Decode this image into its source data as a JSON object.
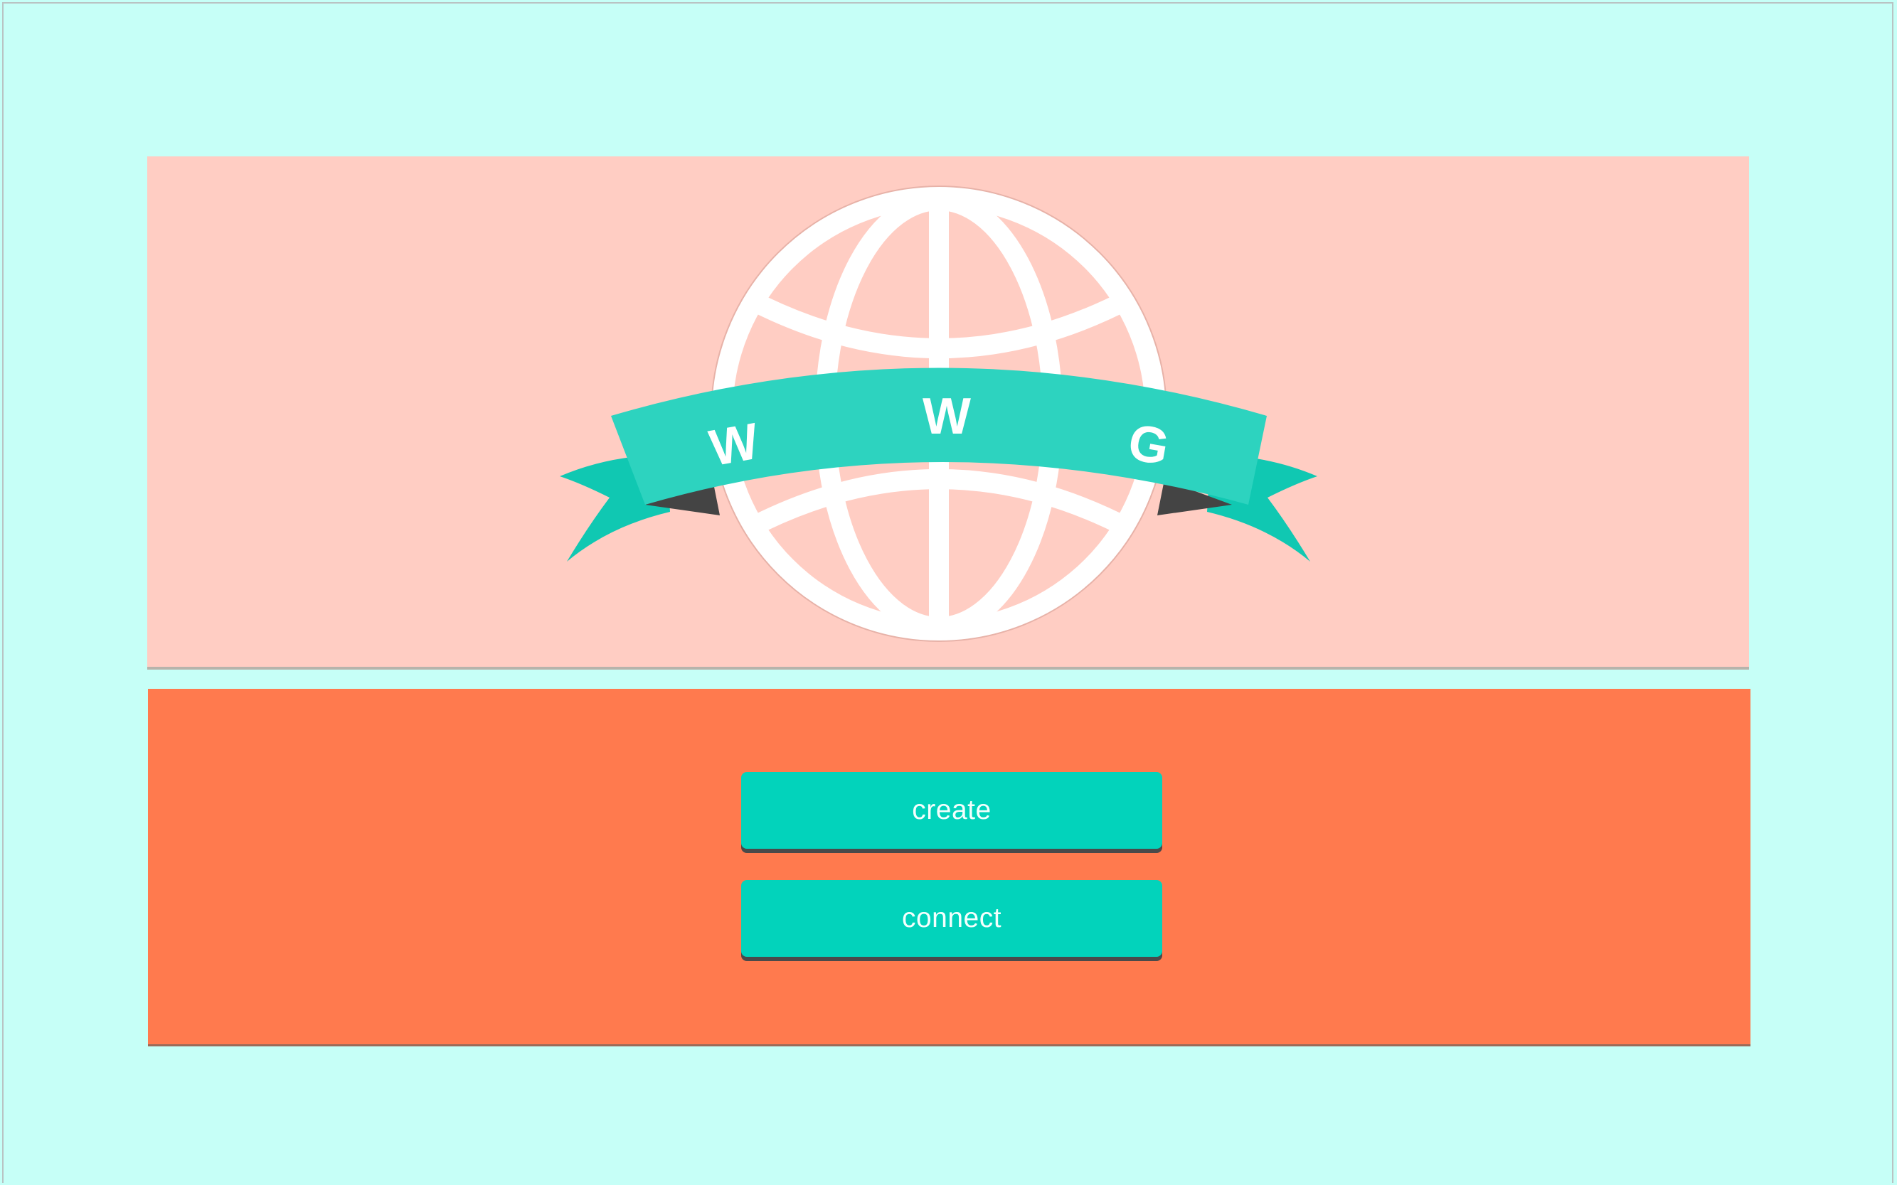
{
  "app": {
    "logo": {
      "icon": "globe-with-ribbon",
      "letters": [
        "W",
        "W",
        "G"
      ],
      "colors": {
        "globe": "#ffffff",
        "ribbon": "#2dd3bf",
        "ribbon_tail": "#10c8b2",
        "ribbon_fold": "#444444"
      }
    },
    "actions": {
      "create_label": "create",
      "connect_label": "connect"
    },
    "colors": {
      "background": "#c6fff7",
      "hero": "#ffcdc3",
      "panel": "#ff7a4e",
      "button": "#02d3bb"
    }
  }
}
